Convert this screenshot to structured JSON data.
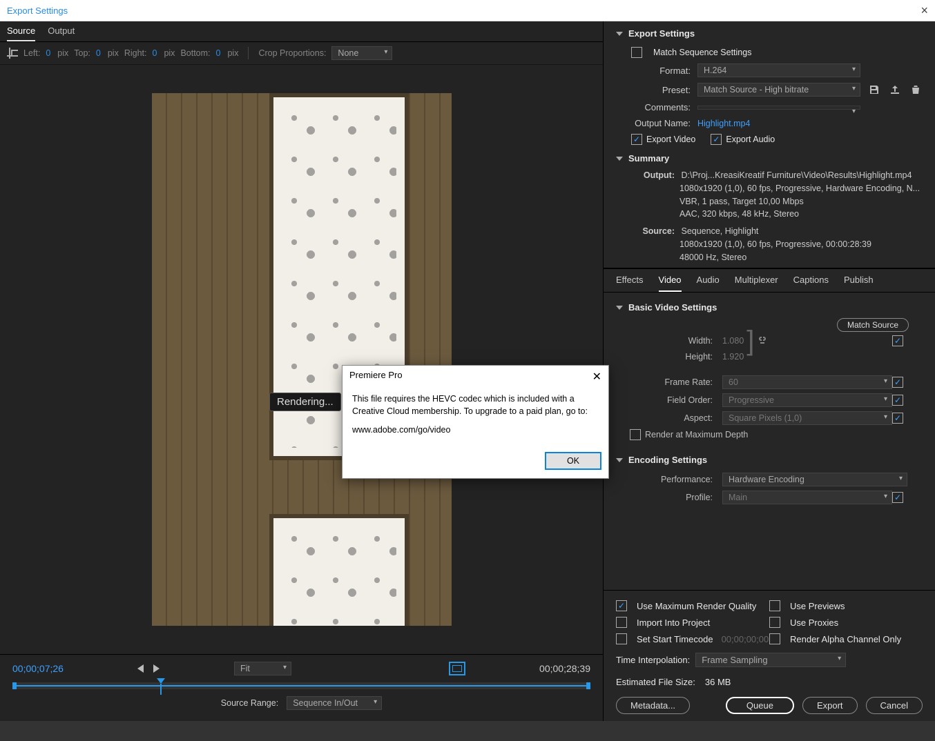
{
  "window": {
    "title": "Export Settings"
  },
  "tabs": {
    "source": "Source",
    "output": "Output"
  },
  "cropbar": {
    "left": "Left:",
    "left_val": "0",
    "left_unit": "pix",
    "top": "Top:",
    "top_val": "0",
    "top_unit": "pix",
    "right": "Right:",
    "right_val": "0",
    "right_unit": "pix",
    "bottom": "Bottom:",
    "bottom_val": "0",
    "bottom_unit": "pix",
    "crop_label": "Crop Proportions:",
    "crop_value": "None"
  },
  "rendering": "Rendering...",
  "dialog": {
    "title": "Premiere Pro",
    "body": "This file requires the HEVC codec which is included with a Creative Cloud membership. To upgrade to a paid plan, go to:",
    "link": "www.adobe.com/go/video",
    "ok": "OK"
  },
  "timeline": {
    "tc_left": "00;00;07;26",
    "fit": "Fit",
    "tc_right": "00;00;28;39",
    "src_range_label": "Source Range:",
    "src_range_value": "Sequence In/Out"
  },
  "export": {
    "header": "Export Settings",
    "match_seq": "Match Sequence Settings",
    "format_label": "Format:",
    "format_value": "H.264",
    "preset_label": "Preset:",
    "preset_value": "Match Source - High bitrate",
    "comments_label": "Comments:",
    "output_name_label": "Output Name:",
    "output_name_value": "Highlight.mp4",
    "export_video": "Export Video",
    "export_audio": "Export Audio"
  },
  "summary": {
    "header": "Summary",
    "output_k": "Output:",
    "output_l1": "D:\\Proj...KreasiKreatif Furniture\\Video\\Results\\Highlight.mp4",
    "output_l2": "1080x1920 (1,0), 60 fps, Progressive, Hardware Encoding, N...",
    "output_l3": "VBR, 1 pass, Target 10,00 Mbps",
    "output_l4": "AAC, 320 kbps, 48 kHz, Stereo",
    "source_k": "Source:",
    "source_l1": "Sequence, Highlight",
    "source_l2": "1080x1920 (1,0), 60 fps, Progressive, 00:00:28:39",
    "source_l3": "48000 Hz, Stereo"
  },
  "tabs2": {
    "effects": "Effects",
    "video": "Video",
    "audio": "Audio",
    "multiplexer": "Multiplexer",
    "captions": "Captions",
    "publish": "Publish"
  },
  "basic": {
    "header": "Basic Video Settings",
    "match_source": "Match Source",
    "width_l": "Width:",
    "width_v": "1.080",
    "height_l": "Height:",
    "height_v": "1.920",
    "fr_l": "Frame Rate:",
    "fr_v": "60",
    "fo_l": "Field Order:",
    "fo_v": "Progressive",
    "asp_l": "Aspect:",
    "asp_v": "Square Pixels (1,0)",
    "maxdepth": "Render at Maximum Depth"
  },
  "encoding": {
    "header": "Encoding Settings",
    "perf_l": "Performance:",
    "perf_v": "Hardware Encoding",
    "prof_l": "Profile:",
    "prof_v": "Main"
  },
  "bottom": {
    "max_render": "Use Maximum Render Quality",
    "use_previews": "Use Previews",
    "import_project": "Import Into Project",
    "use_proxies": "Use Proxies",
    "set_start_tc": "Set Start Timecode",
    "tc_placeholder": "00;00;00;00",
    "render_alpha": "Render Alpha Channel Only",
    "time_interp_l": "Time Interpolation:",
    "time_interp_v": "Frame Sampling",
    "est_size_l": "Estimated File Size:",
    "est_size_v": "36 MB",
    "metadata": "Metadata...",
    "queue": "Queue",
    "export": "Export",
    "cancel": "Cancel"
  }
}
